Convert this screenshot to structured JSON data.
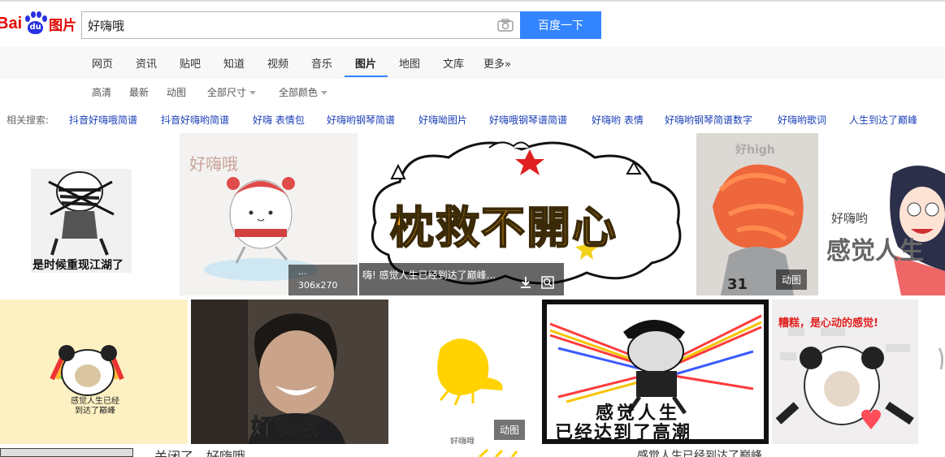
{
  "logo": {
    "text_bai": "Bai",
    "text_du": "du",
    "text_tupian": "图片"
  },
  "search": {
    "value": "好嗨哦",
    "placeholder": "",
    "button_label": "百度一下"
  },
  "nav": {
    "items": [
      "网页",
      "资讯",
      "贴吧",
      "知道",
      "视频",
      "音乐",
      "图片",
      "地图",
      "文库",
      "更多»"
    ],
    "active": "图片"
  },
  "filters": {
    "items": [
      "高清",
      "最新",
      "动图",
      "全部尺寸",
      "全部颜色"
    ]
  },
  "related": {
    "label": "相关搜索:",
    "links": [
      "抖音好嗨哦简谱",
      "抖音好嗨哟简谱",
      "好嗨 表情包",
      "好嗨哟钢琴简谱",
      "好嗨呦图片",
      "好嗨哦钢琴谱简谱",
      "好嗨哟 表情",
      "好嗨哟钢琴简谱数字",
      "好嗨哟歌词",
      "人生到达了巅峰"
    ]
  },
  "images": {
    "img1_caption": "是时候重现江湖了",
    "img2_title": "好嗨哦",
    "img2_dims": "306x270",
    "img2_dots": "...",
    "img3_text": "枕救不開心",
    "img3_caption": "嗨!  感觉人生已经到达了巅峰...",
    "img4_text": "好high",
    "img4_jersey": "31",
    "img5_text1": "好嗨哟",
    "img5_text2": "感觉人生",
    "img6_text": "感觉人生已经\n到达了巅峰",
    "img7_subtitle": "好嗨哦",
    "img8_text": "好嗨哦",
    "img9_line1": "感觉人生",
    "img9_line2": "已经达到了高潮",
    "img10_text": "糟糕，是心动的感觉!",
    "gif_badge": "动图",
    "bottom_text1": "关闭了，好嗨哦",
    "bottom_text2": "感觉人生已经到达了巅峰"
  },
  "colors": {
    "accent": "#3385ff",
    "link": "#1a3fb8",
    "logo_red": "#e10602",
    "logo_blue": "#2932e1"
  }
}
